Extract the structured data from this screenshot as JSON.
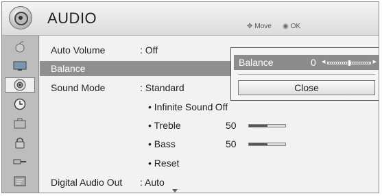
{
  "header": {
    "title": "AUDIO",
    "hint_move": "Move",
    "hint_ok": "OK",
    "icon": "speaker-icon"
  },
  "sidebar": {
    "items": [
      {
        "icon": "apple-icon"
      },
      {
        "icon": "tv-icon"
      },
      {
        "icon": "speaker-icon",
        "active": true
      },
      {
        "icon": "clock-icon"
      },
      {
        "icon": "suitcase-icon"
      },
      {
        "icon": "lock-icon"
      },
      {
        "icon": "plug-icon"
      },
      {
        "icon": "support-icon"
      }
    ]
  },
  "menu": {
    "auto_volume": {
      "label": "Auto Volume",
      "value": ": Off"
    },
    "balance": {
      "label": "Balance"
    },
    "sound_mode": {
      "label": "Sound Mode",
      "value": ": Standard"
    },
    "infinite_sound": {
      "label": "• Infinite Sound",
      "value": ": Off"
    },
    "treble": {
      "label": "• Treble",
      "value": "50",
      "level": 0.5
    },
    "bass": {
      "label": "• Bass",
      "value": "50",
      "level": 0.5
    },
    "reset": {
      "label": "• Reset"
    },
    "digital_audio_out": {
      "label": "Digital Audio Out",
      "value": ": Auto"
    }
  },
  "popup": {
    "label": "Balance",
    "value": "0",
    "slider_position": 0.5,
    "close_label": "Close"
  }
}
